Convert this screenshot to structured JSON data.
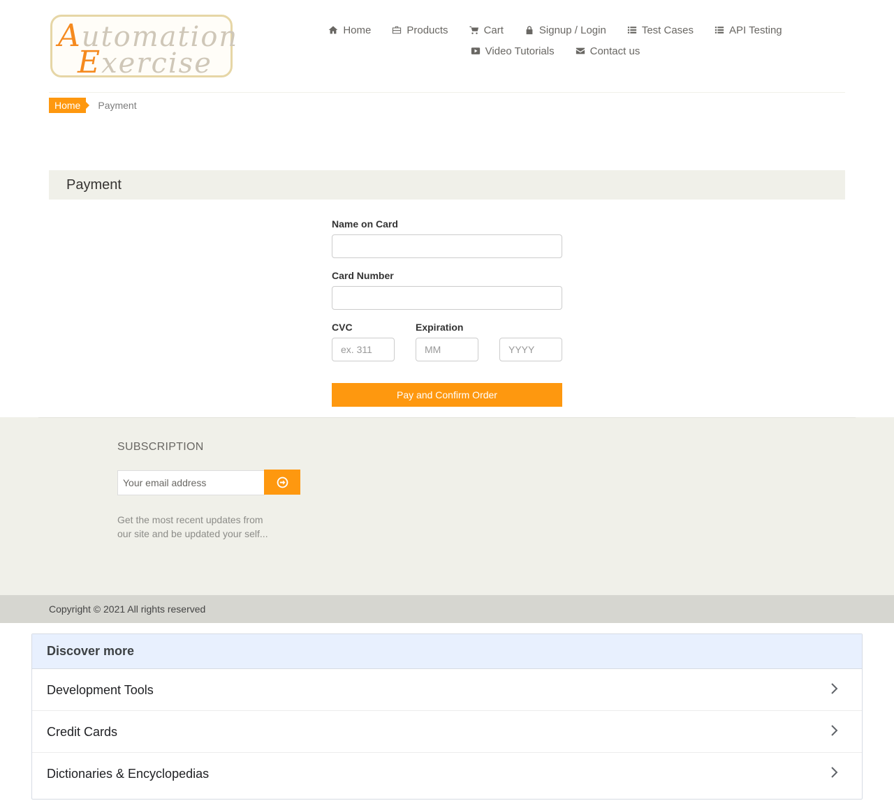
{
  "logo": {
    "line1_cap": "A",
    "line1_rest": "utomation",
    "line2_cap": "E",
    "line2_rest": "xercise"
  },
  "nav": {
    "row1": [
      {
        "label": "Home",
        "icon": "home-icon"
      },
      {
        "label": "Products",
        "icon": "briefcase-icon"
      },
      {
        "label": "Cart",
        "icon": "cart-icon"
      },
      {
        "label": "Signup / Login",
        "icon": "lock-icon"
      },
      {
        "label": "Test Cases",
        "icon": "list-icon"
      },
      {
        "label": "API Testing",
        "icon": "list-icon"
      }
    ],
    "row2": [
      {
        "label": "Video Tutorials",
        "icon": "youtube-icon"
      },
      {
        "label": "Contact us",
        "icon": "envelope-icon"
      }
    ]
  },
  "breadcrumb": {
    "home": "Home",
    "current": "Payment"
  },
  "payment": {
    "title": "Payment",
    "name_label": "Name on Card",
    "name_value": "",
    "card_label": "Card Number",
    "card_value": "",
    "cvc_label": "CVC",
    "cvc_placeholder": "ex. 311",
    "expiration_label": "Expiration",
    "month_placeholder": "MM",
    "year_placeholder": "YYYY",
    "submit_label": "Pay and Confirm Order"
  },
  "subscription": {
    "title": "SUBSCRIPTION",
    "email_placeholder": "Your email address",
    "description": "Get the most recent updates from our site and be updated your self...",
    "button_icon": "arrow-circle-right-icon"
  },
  "footer": {
    "copyright": "Copyright © 2021 All rights reserved"
  },
  "discover": {
    "title": "Discover more",
    "items": [
      "Development Tools",
      "Credit Cards",
      "Dictionaries & Encyclopedias"
    ]
  },
  "colors": {
    "accent": "#fe980f",
    "panel": "#f0f0e9",
    "discover_head": "#e8f0fe"
  }
}
